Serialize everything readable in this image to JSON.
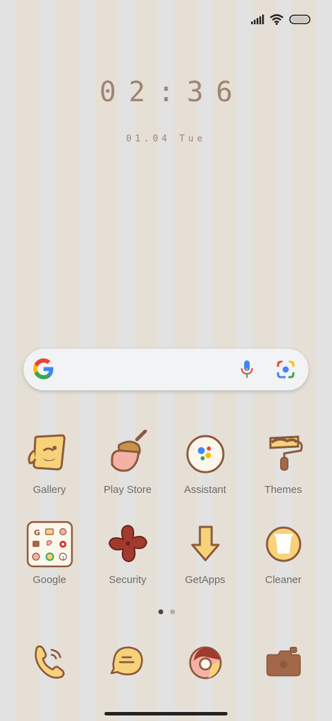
{
  "status_bar": {
    "signal_icon": "signal-bars-icon",
    "wifi_icon": "wifi-icon",
    "battery_icon": "battery-icon"
  },
  "lockclock": {
    "time": "02:36",
    "date": "01.04 Tue"
  },
  "search_bar": {
    "logo_icon": "google-g-icon",
    "mic_icon": "microphone-icon",
    "lens_icon": "google-lens-icon"
  },
  "apps_row1": [
    {
      "label": "Gallery",
      "icon": "gallery-icon"
    },
    {
      "label": "Play Store",
      "icon": "play-store-icon"
    },
    {
      "label": "Assistant",
      "icon": "assistant-icon"
    },
    {
      "label": "Themes",
      "icon": "themes-icon"
    }
  ],
  "apps_row2": [
    {
      "label": "Google",
      "icon": "google-folder-icon"
    },
    {
      "label": "Security",
      "icon": "security-icon"
    },
    {
      "label": "GetApps",
      "icon": "getapps-icon"
    },
    {
      "label": "Cleaner",
      "icon": "cleaner-icon"
    }
  ],
  "page_indicator": {
    "pages": 2,
    "current": 1
  },
  "dock": [
    {
      "label": "Phone",
      "icon": "phone-icon"
    },
    {
      "label": "Messages",
      "icon": "messages-icon"
    },
    {
      "label": "Chrome",
      "icon": "chrome-icon"
    },
    {
      "label": "Camera",
      "icon": "camera-icon"
    }
  ],
  "colors": {
    "wallpaper_stripe_a": "#e2e2e2",
    "wallpaper_stripe_b": "#e6dfd5",
    "clock_text": "#9f8471",
    "icon_outline": "#8b5a3c",
    "icon_yellow": "#f7d27a"
  }
}
